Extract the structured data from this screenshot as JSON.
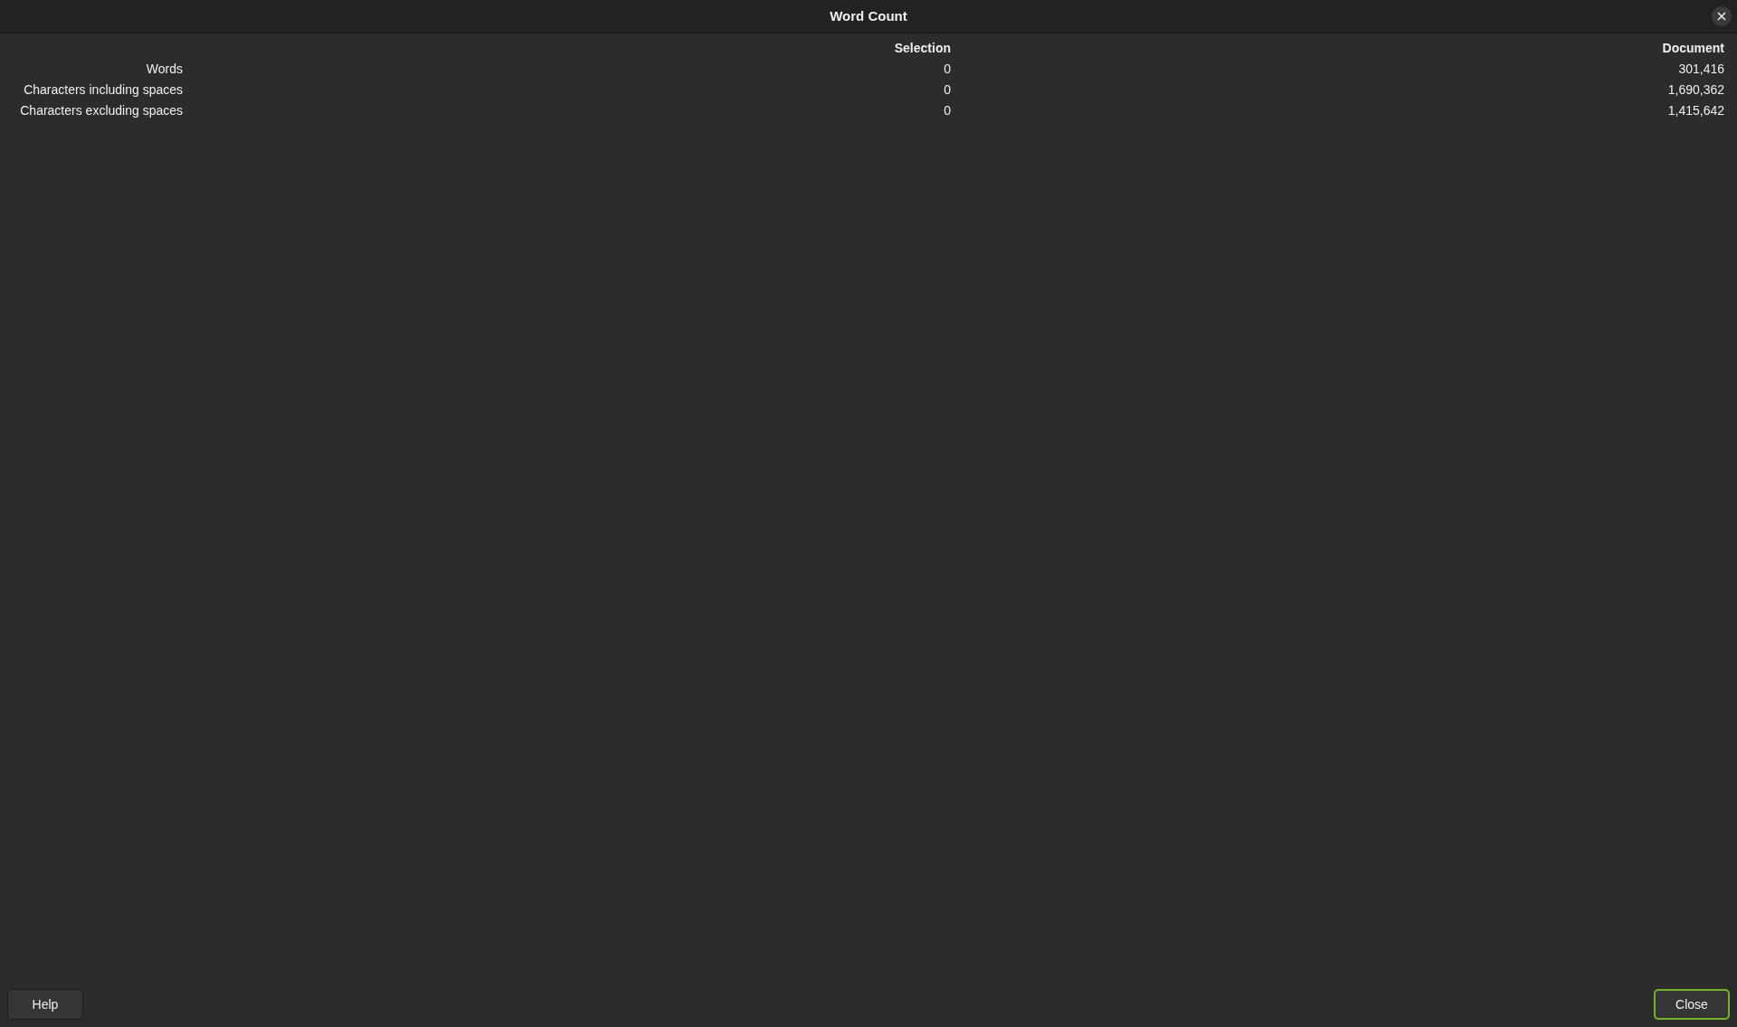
{
  "window": {
    "title": "Word Count"
  },
  "table": {
    "columns": [
      "Selection",
      "Document"
    ],
    "rows": [
      {
        "label": "Words",
        "selection": "0",
        "document": "301,416"
      },
      {
        "label": "Characters including spaces",
        "selection": "0",
        "document": "1,690,362"
      },
      {
        "label": "Characters excluding spaces",
        "selection": "0",
        "document": "1,415,642"
      }
    ]
  },
  "buttons": [
    {
      "label": "Help",
      "default": false
    },
    {
      "label": "Close",
      "default": true
    }
  ]
}
